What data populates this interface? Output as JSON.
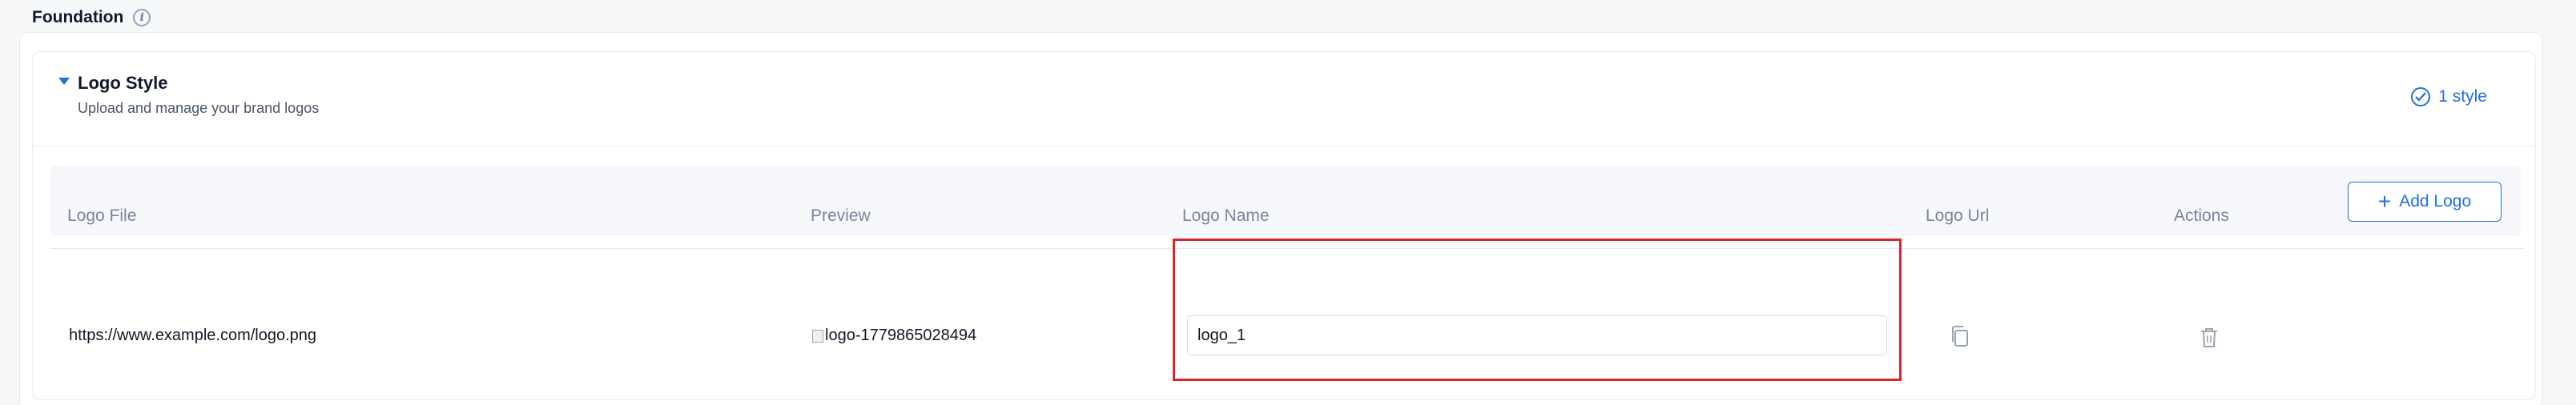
{
  "section": {
    "title": "Foundation",
    "info_icon": "info-icon"
  },
  "logo_style": {
    "title": "Logo Style",
    "subtitle": "Upload and manage your brand logos",
    "badge": "1 style"
  },
  "toolbar": {
    "add_logo_label": "Add Logo"
  },
  "table": {
    "columns": [
      "Logo File",
      "Preview",
      "Logo Name",
      "Logo Url",
      "Actions"
    ],
    "rows": [
      {
        "logo_file": "https://www.example.com/logo.png",
        "preview_alt": "logo-1779865028494",
        "logo_name": "logo_1"
      }
    ]
  },
  "colors": {
    "accent": "#1f6fde",
    "highlight": "#d9262c",
    "muted_text": "#7a8599"
  }
}
